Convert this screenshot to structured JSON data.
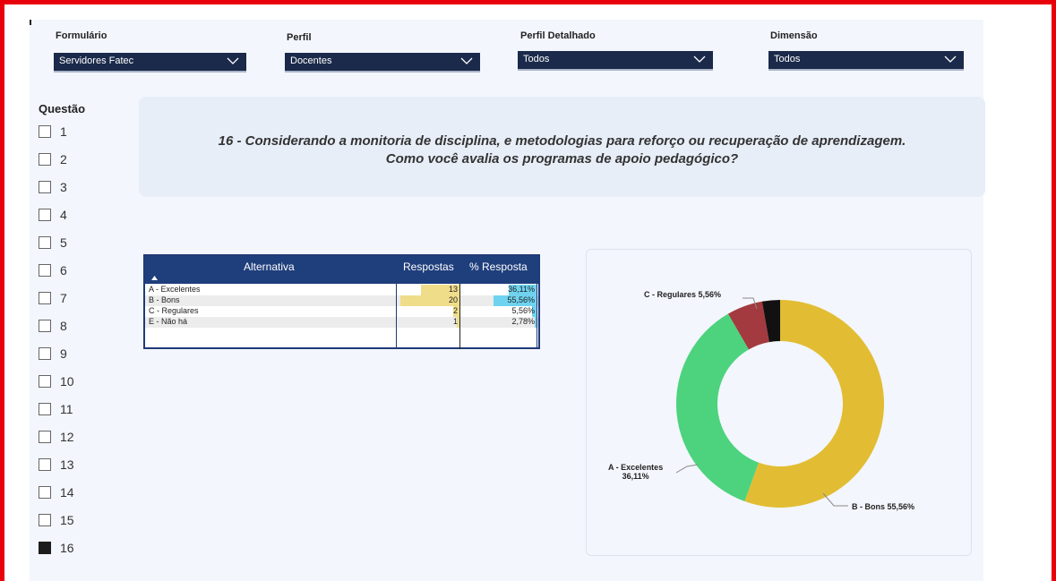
{
  "filters": [
    {
      "label": "Formulário",
      "value": "Servidores Fatec"
    },
    {
      "label": "Perfil",
      "value": "Docentes"
    },
    {
      "label": "Perfil Detalhado",
      "value": "Todos"
    },
    {
      "label": "Dimensão",
      "value": "Todos"
    }
  ],
  "questions": {
    "title": "Questão",
    "items": [
      "1",
      "2",
      "3",
      "4",
      "5",
      "6",
      "7",
      "8",
      "9",
      "10",
      "11",
      "12",
      "13",
      "14",
      "15",
      "16"
    ],
    "selected": "16"
  },
  "question_text": {
    "line1": "16 - Considerando a monitoria de disciplina, e metodologias para reforço ou recuperação de aprendizagem.",
    "line2": "Como você avalia os programas de apoio pedagógico?"
  },
  "table": {
    "headers": {
      "alternativa": "Alternativa",
      "respostas": "Respostas",
      "pct": "% Resposta"
    },
    "rows": [
      {
        "label": "A - Excelentes",
        "respostas": "13",
        "pct": "36,11%",
        "resp_value": 13,
        "pct_value": 36.11
      },
      {
        "label": "B - Bons",
        "respostas": "20",
        "pct": "55,56%",
        "resp_value": 20,
        "pct_value": 55.56
      },
      {
        "label": "C - Regulares",
        "respostas": "2",
        "pct": "5,56%",
        "resp_value": 2,
        "pct_value": 5.56
      },
      {
        "label": "E - Não há",
        "respostas": "1",
        "pct": "2,78%",
        "resp_value": 1,
        "pct_value": 2.78
      }
    ]
  },
  "chart_data": {
    "type": "pie",
    "categories": [
      "B - Bons",
      "A - Excelentes",
      "C - Regulares",
      "E - Não há"
    ],
    "values": [
      55.56,
      36.11,
      5.56,
      2.78
    ],
    "colors": [
      "#e2bd33",
      "#4dd37e",
      "#a33a3f",
      "#111111"
    ],
    "labels": {
      "regulares": "C - Regulares 5,56%",
      "excelentes_line1": "A - Excelentes",
      "excelentes_line2": "36,11%",
      "bons": "B - Bons 55,56%"
    }
  }
}
